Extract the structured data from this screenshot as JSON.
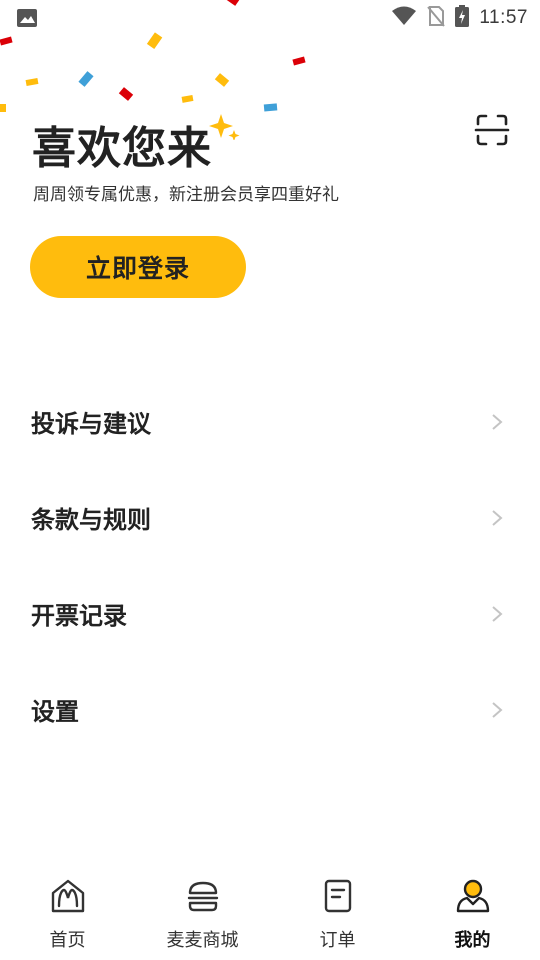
{
  "status_bar": {
    "time": "11:57",
    "icons": [
      "image-icon",
      "wifi-icon",
      "no-sim-icon",
      "battery-charging-icon"
    ]
  },
  "welcome": {
    "title": "喜欢您来",
    "subtitle": "周周领专属优惠，新注册会员享四重好礼",
    "scan_icon": "scan-icon"
  },
  "login_button": {
    "label": "立即登录",
    "color": "#ffbc0d"
  },
  "menu": {
    "items": [
      {
        "label": "投诉与建议"
      },
      {
        "label": "条款与规则"
      },
      {
        "label": "开票记录"
      },
      {
        "label": "设置"
      }
    ]
  },
  "tabbar": {
    "items": [
      {
        "label": "首页",
        "icon": "home-icon"
      },
      {
        "label": "麦麦商城",
        "icon": "burger-icon"
      },
      {
        "label": "订单",
        "icon": "order-icon"
      },
      {
        "label": "我的",
        "icon": "profile-icon",
        "active": true
      }
    ],
    "active_color": "#ffbc0d"
  }
}
